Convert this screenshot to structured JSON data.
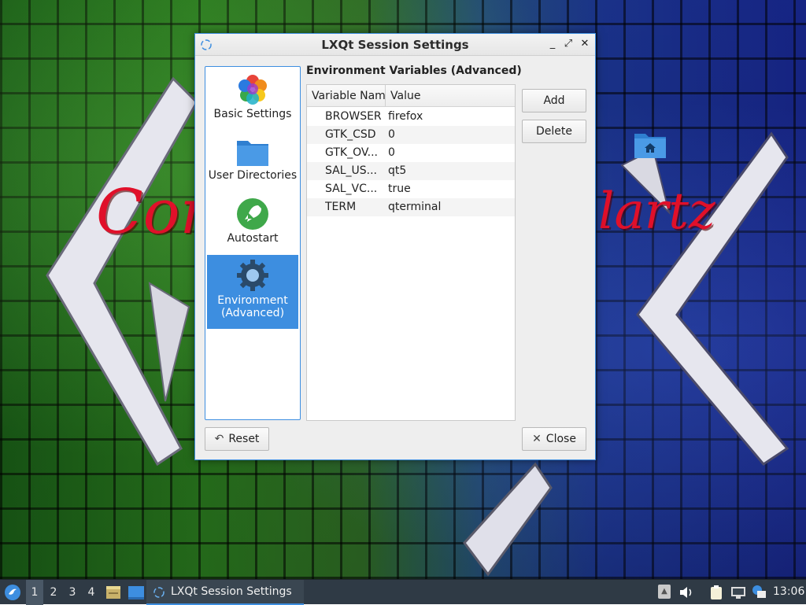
{
  "desktop": {
    "wallpaper_text_left": "Con",
    "wallpaper_text_right": "lartz"
  },
  "window": {
    "title": "LXQt Session Settings",
    "controls": {
      "minimize": "_",
      "maximize": "⤢",
      "close": "✕"
    }
  },
  "sidebar": {
    "items": [
      {
        "label": "Basic Settings",
        "icon": "multicolor-flower-icon",
        "selected": false
      },
      {
        "label": "User Directories",
        "icon": "folder-icon",
        "selected": false
      },
      {
        "label": "Autostart",
        "icon": "rocket-icon",
        "selected": false
      },
      {
        "label": "Environment (Advanced)",
        "icon": "gear-icon",
        "selected": true
      }
    ]
  },
  "main": {
    "section_title": "Environment Variables (Advanced)",
    "columns": [
      "Variable Nam",
      "Value"
    ],
    "rows": [
      {
        "name": "BROWSER",
        "value": "firefox"
      },
      {
        "name": "GTK_CSD",
        "value": "0"
      },
      {
        "name": "GTK_OV...",
        "value": "0"
      },
      {
        "name": "SAL_US...",
        "value": "qt5"
      },
      {
        "name": "SAL_VC...",
        "value": "true"
      },
      {
        "name": "TERM",
        "value": "qterminal"
      }
    ],
    "add_label": "Add",
    "delete_label": "Delete"
  },
  "footer": {
    "reset_label": "Reset",
    "close_label": "Close"
  },
  "taskbar": {
    "desktops": [
      "1",
      "2",
      "3",
      "4"
    ],
    "active_desktop": "1",
    "task_label": "LXQt Session Settings",
    "clock": "13:06"
  },
  "colors": {
    "accent": "#3d8ee0",
    "taskbar": "#2f3a45",
    "window_bg": "#eeeeee"
  }
}
